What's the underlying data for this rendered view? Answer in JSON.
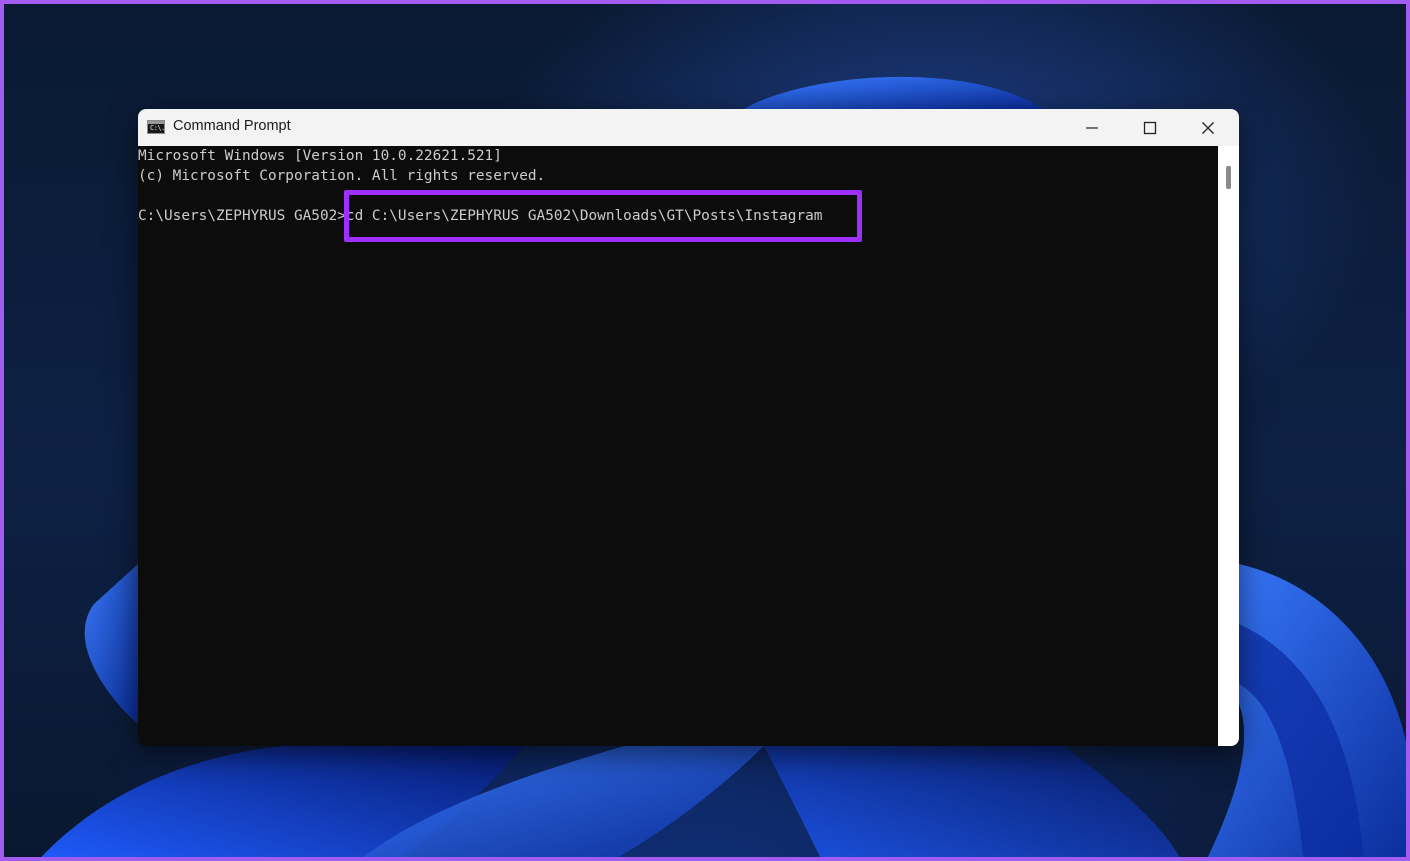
{
  "window": {
    "title": "Command Prompt",
    "icon": "cmd-icon",
    "icon_text": "C:\\."
  },
  "controls": {
    "minimize_icon": "minimize-icon",
    "maximize_icon": "maximize-icon",
    "close_icon": "close-icon"
  },
  "console": {
    "lines": [
      "Microsoft Windows [Version 10.0.22621.521]",
      "(c) Microsoft Corporation. All rights reserved.",
      "C:\\Users\\ZEPHYRUS GA502>cd C:\\Users\\ZEPHYRUS GA502\\Downloads\\GT\\Posts\\Instagram"
    ]
  },
  "colors": {
    "highlight_border": "#9b30ff",
    "page_frame": "#a35cf0",
    "console_bg": "#0c0c0c",
    "console_text": "#cccccc"
  }
}
